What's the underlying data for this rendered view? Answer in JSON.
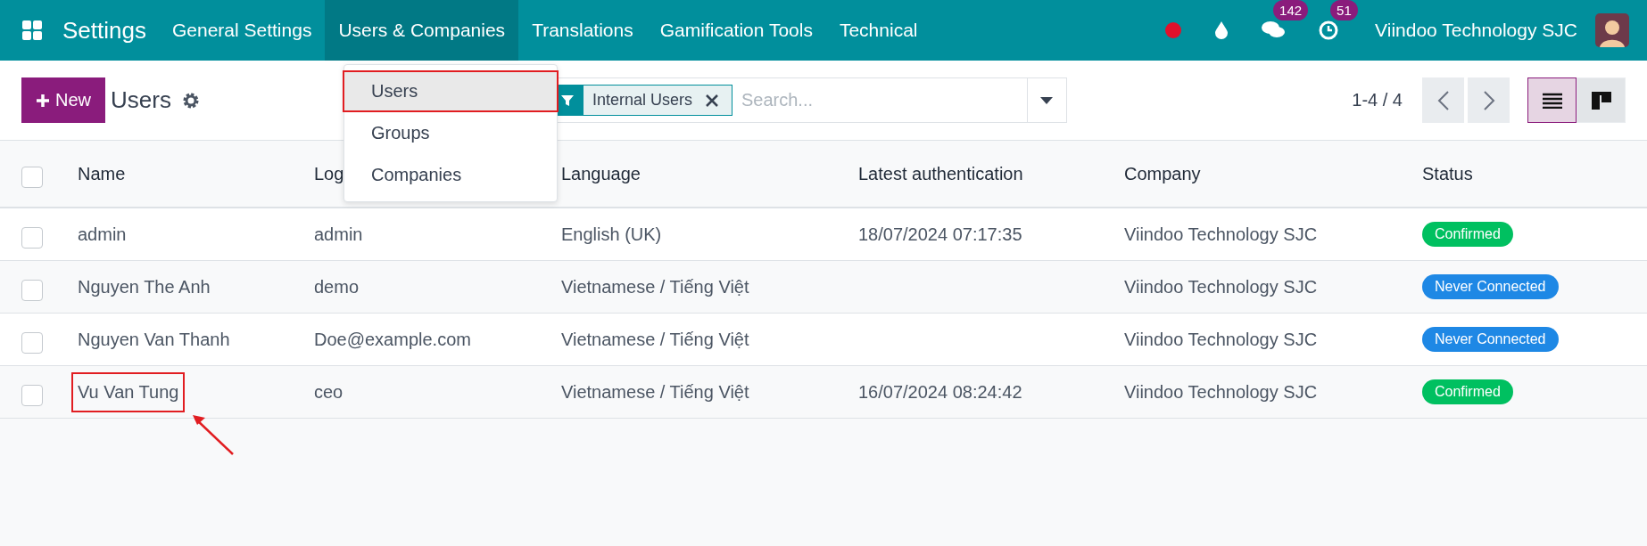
{
  "navbar": {
    "app_name": "Settings",
    "menus": [
      {
        "label": "General Settings",
        "selected": false
      },
      {
        "label": "Users & Companies",
        "selected": true
      },
      {
        "label": "Translations",
        "selected": false
      },
      {
        "label": "Gamification Tools",
        "selected": false
      },
      {
        "label": "Technical",
        "selected": false
      }
    ],
    "messages_badge": "142",
    "activities_badge": "51",
    "company": "Viindoo Technology SJC"
  },
  "dropdown": {
    "items": [
      {
        "label": "Users",
        "highlighted": true
      },
      {
        "label": "Groups",
        "highlighted": false
      },
      {
        "label": "Companies",
        "highlighted": false
      }
    ]
  },
  "control_panel": {
    "new_button": "New",
    "title": "Users",
    "facet": "Internal Users",
    "search": {
      "placeholder": "Search..."
    },
    "pager": "1-4 / 4",
    "views": [
      {
        "kind": "list",
        "selected": true
      },
      {
        "kind": "kanban",
        "selected": false
      }
    ]
  },
  "table": {
    "select_all_checked": false,
    "columns": [
      "Name",
      "Log",
      "Language",
      "Latest authentication",
      "Company",
      "Status"
    ],
    "rows": [
      {
        "checked": false,
        "annotated": false,
        "name": "admin",
        "login": "admin",
        "language": "English (UK)",
        "latest_authentication": "18/07/2024 07:17:35",
        "company": "Viindoo Technology SJC",
        "status": {
          "label": "Confirmed",
          "kind": "confirmed"
        }
      },
      {
        "checked": false,
        "annotated": false,
        "name": "Nguyen The Anh",
        "login": "demo",
        "language": "Vietnamese / Tiếng Việt",
        "company": "Viindoo Technology SJC",
        "status": {
          "label": "Never Connected",
          "kind": "never"
        }
      },
      {
        "checked": false,
        "annotated": false,
        "name": "Nguyen Van Thanh",
        "login": "Doe@example.com",
        "language": "Vietnamese / Tiếng Việt",
        "company": "Viindoo Technology SJC",
        "status": {
          "label": "Never Connected",
          "kind": "never"
        }
      },
      {
        "checked": false,
        "annotated": true,
        "name": "Vu Van Tung",
        "login": "ceo",
        "language": "Vietnamese / Tiếng Việt",
        "latest_authentication": "16/07/2024 08:24:42",
        "company": "Viindoo Technology SJC",
        "status": {
          "label": "Confirmed",
          "kind": "confirmed"
        }
      }
    ]
  }
}
